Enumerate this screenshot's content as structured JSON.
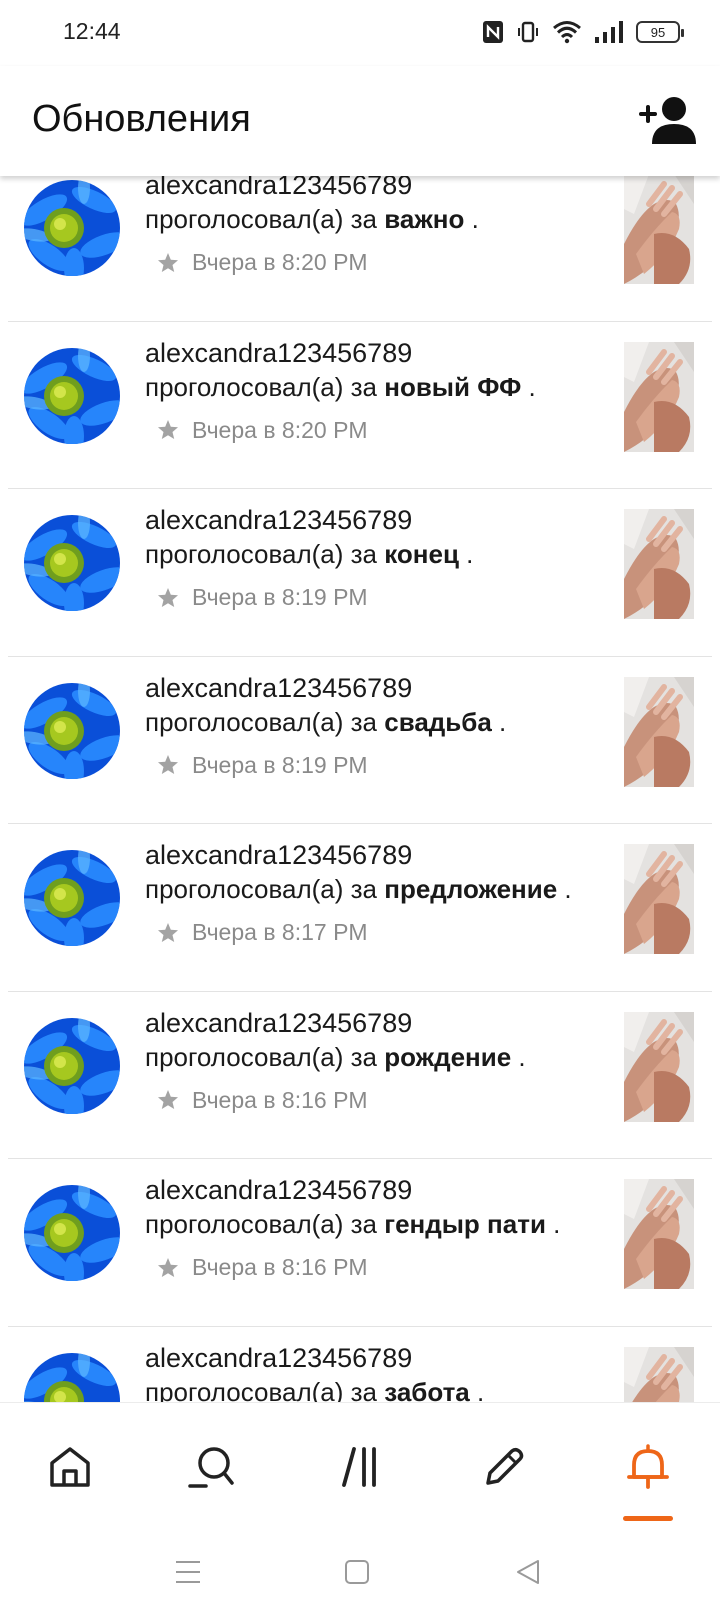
{
  "status_bar": {
    "time": "12:44",
    "battery": "95",
    "icons": [
      "nfc-icon",
      "vibrate-icon",
      "wifi-icon",
      "signal-icon",
      "battery-icon"
    ]
  },
  "header": {
    "title": "Обновления",
    "action_icon": "add-user-icon"
  },
  "updates": [
    {
      "username": "alexcandra123456789",
      "action": "проголосовал(а) за",
      "target": "важно",
      "suffix": " .",
      "time": "Вчера в 8:20 PM"
    },
    {
      "username": "alexcandra123456789",
      "action": "проголосовал(а) за",
      "target": "новый ФФ",
      "suffix": " .",
      "time": "Вчера в 8:20 PM"
    },
    {
      "username": "alexcandra123456789",
      "action": "проголосовал(а) за",
      "target": "конец",
      "suffix": " .",
      "time": "Вчера в 8:19 PM"
    },
    {
      "username": "alexcandra123456789",
      "action": "проголосовал(а) за",
      "target": "свадьба",
      "suffix": " .",
      "time": "Вчера в 8:19 PM"
    },
    {
      "username": "alexcandra123456789",
      "action": "проголосовал(а) за",
      "target": "предложение",
      "suffix": " .",
      "time": "Вчера в 8:17 PM"
    },
    {
      "username": "alexcandra123456789",
      "action": "проголосовал(а) за",
      "target": "рождение",
      "suffix": " .",
      "time": "Вчера в 8:16 PM"
    },
    {
      "username": "alexcandra123456789",
      "action": "проголосовал(а) за",
      "target": "гендыр пати",
      "suffix": " .",
      "time": "Вчера в 8:16 PM"
    },
    {
      "username": "alexcandra123456789",
      "action": "проголосовал(а) за",
      "target": "забота",
      "suffix": " .",
      "time": ""
    }
  ],
  "bottom_nav": {
    "items": [
      "home-icon",
      "search-icon",
      "library-icon",
      "write-icon",
      "notifications-icon"
    ],
    "active": "notifications-icon",
    "accent": "#ee6618"
  },
  "system_nav": {
    "items": [
      "menu-icon",
      "home-square-icon",
      "back-icon"
    ]
  }
}
